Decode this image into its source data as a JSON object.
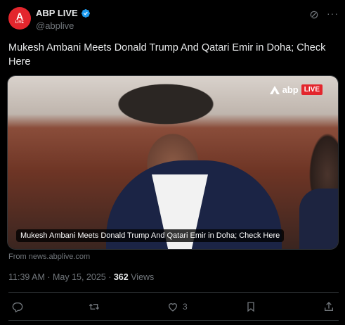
{
  "header": {
    "avatar_mark": "A",
    "avatar_sub": "LIVE",
    "display_name": "ABP LIVE",
    "handle": "@abplive"
  },
  "tweet": {
    "text": "Mukesh Ambani Meets Donald Trump And Qatari Emir in Doha; Check Here"
  },
  "card": {
    "brand_text": "abp",
    "brand_live": "LIVE",
    "caption": "Mukesh Ambani Meets Donald Trump And Qatari Emir in Doha; Check Here",
    "source": "From news.abplive.com"
  },
  "meta": {
    "time": "11:39 AM · May 15, 2025 · ",
    "views_count": "362",
    "views_label": " Views"
  },
  "actions": {
    "likes": "3"
  },
  "colors": {
    "brand_red": "#e3262d",
    "verified_blue": "#1d9bf0"
  }
}
